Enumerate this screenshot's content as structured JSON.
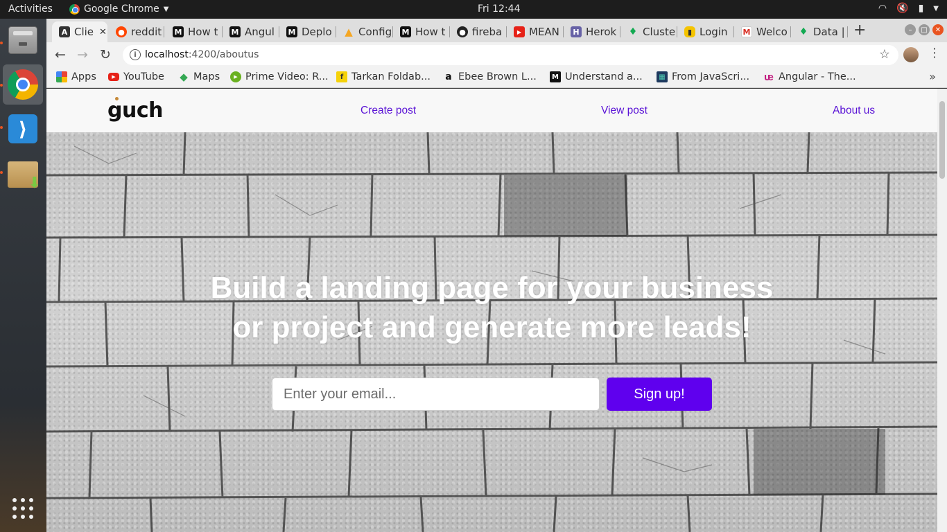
{
  "topbar": {
    "activities": "Activities",
    "app_name": "Google Chrome",
    "clock": "Fri 12:44"
  },
  "tabs": [
    {
      "label": "Clie",
      "icon": "angular-icon",
      "active": true
    },
    {
      "label": "reddit",
      "icon": "reddit-icon"
    },
    {
      "label": "How t",
      "icon": "medium-icon"
    },
    {
      "label": "Angul",
      "icon": "medium-icon"
    },
    {
      "label": "Deplo",
      "icon": "medium-icon"
    },
    {
      "label": "Config",
      "icon": "firebase-icon"
    },
    {
      "label": "How t",
      "icon": "medium-icon"
    },
    {
      "label": "fireba",
      "icon": "github-icon"
    },
    {
      "label": "MEAN",
      "icon": "youtube-icon"
    },
    {
      "label": "Herok",
      "icon": "heroku-icon"
    },
    {
      "label": "Cluste",
      "icon": "mongodb-icon"
    },
    {
      "label": "Login",
      "icon": "login-icon"
    },
    {
      "label": "Welco",
      "icon": "gmail-icon"
    },
    {
      "label": "Data |",
      "icon": "mongodb-icon"
    }
  ],
  "address_bar": {
    "host": "localhost",
    "path": ":4200/aboutus"
  },
  "bookmarks": [
    {
      "label": "Apps",
      "icon": "apps-grid-icon"
    },
    {
      "label": "YouTube",
      "icon": "youtube-icon"
    },
    {
      "label": "Maps",
      "icon": "maps-icon"
    },
    {
      "label": "Prime Video: R...",
      "icon": "prime-video-icon"
    },
    {
      "label": "Tarkan Foldab...",
      "icon": "bookmark-icon"
    },
    {
      "label": "Ebee Brown L...",
      "icon": "amazon-icon"
    },
    {
      "label": "Understand a...",
      "icon": "medium-icon"
    },
    {
      "label": "From JavaScri...",
      "icon": "bookmark-icon"
    },
    {
      "label": "Angular - The...",
      "icon": "udemy-icon"
    }
  ],
  "site": {
    "logo": "guch",
    "nav": [
      "Create post",
      "View post",
      "About us"
    ],
    "hero_title_line1": "Build a landing page for your business",
    "hero_title_line2": "or project and generate more leads!",
    "email_placeholder": "Enter your email...",
    "signup_label": "Sign up!"
  },
  "colors": {
    "accent": "#5f00ee",
    "nav_link": "#5a13d6"
  }
}
